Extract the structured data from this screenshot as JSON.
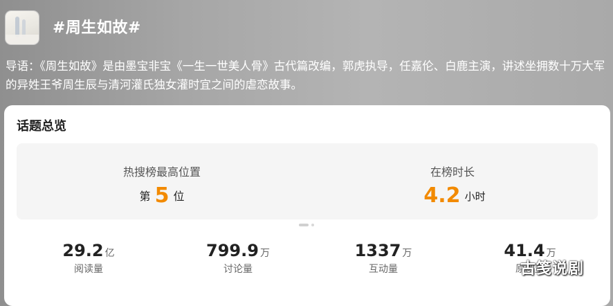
{
  "header": {
    "thumbnail_icon": "poster-thumbnail",
    "topic_title": "#周生如故#",
    "intro": "导语：《周生如故》是由墨宝非宝《一生一世美人骨》古代篇改编，郭虎执导，任嘉伦、白鹿主演，讲述坐拥数十万大军的异姓王爷周生辰与清河灌氏独女灌时宜之间的虐恋故事。"
  },
  "overview": {
    "title": "话题总览",
    "hot_search": {
      "label": "热搜榜最高位置",
      "prefix": "第",
      "value": "5",
      "suffix": "位"
    },
    "duration": {
      "label": "在榜时长",
      "value": "4.2",
      "unit": "小时"
    },
    "accent_color": "#f28a00"
  },
  "metrics": [
    {
      "value": "29.2",
      "unit": "亿",
      "label": "阅读量"
    },
    {
      "value": "799.9",
      "unit": "万",
      "label": "讨论量"
    },
    {
      "value": "1337",
      "unit": "万",
      "label": "互动量"
    },
    {
      "value": "41.4",
      "unit": "万",
      "label": "原创量"
    }
  ],
  "watermark": "古笺说剧"
}
